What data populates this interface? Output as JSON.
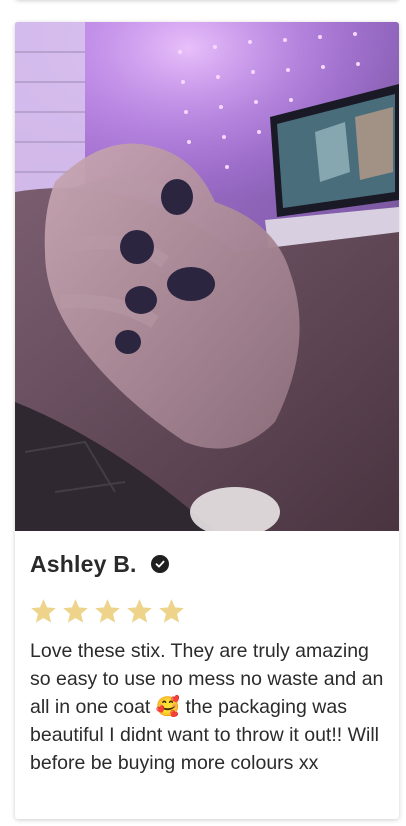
{
  "review": {
    "reviewer_name": "Ashley B.",
    "verified": true,
    "rating": 5,
    "rating_max": 5,
    "star_color": "#edd48a",
    "photo_icon": "hand-with-painted-nails-photo",
    "body": "Love these stix. They are truly amazing so easy to use no mess no waste and an all in one coat 🥰 the packaging was beautiful I didnt want to throw it out!! Will before be buying more colours xx"
  }
}
